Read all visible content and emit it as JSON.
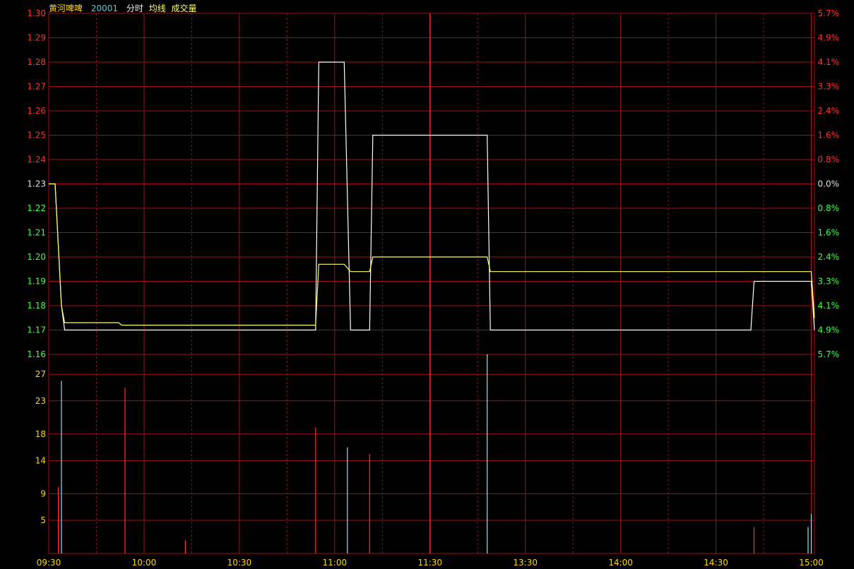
{
  "header": {
    "stock_name": "黄河啤啤",
    "stock_code": "20001",
    "mode_intraday": "分时",
    "mode_avg": "均线",
    "mode_volume": "成交量"
  },
  "colors": {
    "background": "#000000",
    "grid": "#a01010",
    "up": "#ff3030",
    "down": "#40ff40",
    "flat": "#e0e0e0",
    "price_line": "#ffffff",
    "avg_line": "#ffff60",
    "volume_label": "#ffd700",
    "time_label": "#ffd700",
    "header_name": "#ffd700",
    "header_code": "#5fc8d8"
  },
  "chart_data": [
    {
      "type": "line",
      "name": "intraday-price",
      "prev_close": 1.23,
      "ylim": [
        1.16,
        1.3
      ],
      "price_ticks": [
        "1.30",
        "1.29",
        "1.28",
        "1.27",
        "1.26",
        "1.25",
        "1.24",
        "1.23",
        "1.22",
        "1.21",
        "1.20",
        "1.19",
        "1.18",
        "1.17",
        "1.16"
      ],
      "pct_ticks": [
        "5.7%",
        "4.9%",
        "4.1%",
        "3.3%",
        "2.4%",
        "1.6%",
        "0.8%",
        "0.0%",
        "0.8%",
        "1.6%",
        "2.4%",
        "3.3%",
        "4.1%",
        "4.9%",
        "5.7%"
      ],
      "x_labels": [
        "09:30",
        "10:00",
        "10:30",
        "11:00",
        "11:30",
        "13:30",
        "14:00",
        "14:30",
        "15:00"
      ],
      "series": [
        {
          "name": "",
          "role": "price",
          "points": [
            [
              0,
              1.23
            ],
            [
              2,
              1.23
            ],
            [
              4,
              1.18
            ],
            [
              5,
              1.17
            ],
            [
              84,
              1.17
            ],
            [
              85,
              1.28
            ],
            [
              93,
              1.28
            ],
            [
              95,
              1.17
            ],
            [
              101,
              1.17
            ],
            [
              102,
              1.25
            ],
            [
              138,
              1.25
            ],
            [
              139,
              1.17
            ],
            [
              221,
              1.17
            ],
            [
              222,
              1.19
            ],
            [
              240,
              1.19
            ],
            [
              241,
              1.17
            ]
          ]
        },
        {
          "name": "",
          "role": "average",
          "points": [
            [
              0,
              1.23
            ],
            [
              2,
              1.23
            ],
            [
              4,
              1.18
            ],
            [
              5,
              1.173
            ],
            [
              22,
              1.173
            ],
            [
              23,
              1.172
            ],
            [
              84,
              1.172
            ],
            [
              85,
              1.197
            ],
            [
              93,
              1.197
            ],
            [
              95,
              1.194
            ],
            [
              101,
              1.194
            ],
            [
              102,
              1.2
            ],
            [
              138,
              1.2
            ],
            [
              139,
              1.194
            ],
            [
              240,
              1.194
            ],
            [
              241,
              1.175
            ]
          ]
        }
      ]
    },
    {
      "type": "bar",
      "name": "volume",
      "ylim": [
        0,
        30
      ],
      "y_ticks": [
        "27",
        "23",
        "18",
        "14",
        "9",
        "5"
      ],
      "bars": [
        {
          "t": 3,
          "v": 10,
          "dir": "up"
        },
        {
          "t": 4,
          "v": 26,
          "dir": "down"
        },
        {
          "t": 24,
          "v": 25,
          "dir": "up"
        },
        {
          "t": 43,
          "v": 2,
          "dir": "up"
        },
        {
          "t": 84,
          "v": 19,
          "dir": "up"
        },
        {
          "t": 94,
          "v": 16,
          "dir": "down"
        },
        {
          "t": 101,
          "v": 15,
          "dir": "up"
        },
        {
          "t": 138,
          "v": 30,
          "dir": "down"
        },
        {
          "t": 222,
          "v": 4,
          "dir": "up"
        },
        {
          "t": 239,
          "v": 4,
          "dir": "down"
        },
        {
          "t": 240,
          "v": 6,
          "dir": "down"
        }
      ]
    }
  ]
}
